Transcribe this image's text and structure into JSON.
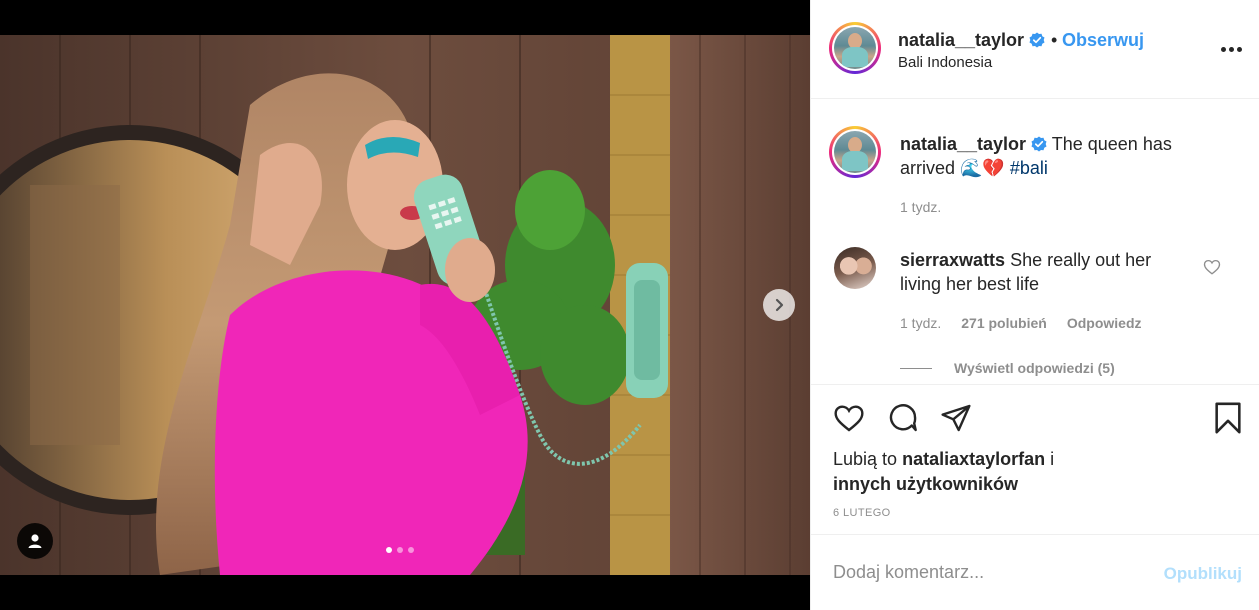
{
  "post": {
    "username": "natalia__taylor",
    "location": "Bali Indonesia",
    "follow_label": "Obserwuj",
    "separator": "•",
    "caption_text": "The queen has arrived 🌊💔",
    "hashtag": "#bali",
    "caption_time": "1 tydz.",
    "likes_prefix": "Lubią to",
    "likes_user": "nataliaxtaylorfan",
    "likes_suffix": "i",
    "likes_others": "innych użytkowników",
    "date": "6 LUTEGO",
    "carousel": {
      "count": 3,
      "active": 0
    }
  },
  "comments": [
    {
      "username": "sierraxwatts",
      "text": "She really out her living her best life",
      "time": "1 tydz.",
      "likes": "271 polubień",
      "reply_label": "Odpowiedz",
      "view_replies": "Wyświetl odpowiedzi (5)"
    }
  ],
  "comment_box": {
    "placeholder": "Dodaj komentarz...",
    "publish_label": "Opublikuj"
  },
  "colors": {
    "accent": "#3897f0",
    "publish_disabled": "#b2dffc",
    "hashtag": "#00376b",
    "muted": "#8e8e8e"
  },
  "icons": {
    "header_more": "more-horizontal-icon",
    "verified": "verified-badge-icon",
    "like": "heart-icon",
    "comment": "comment-bubble-icon",
    "share": "paper-plane-icon",
    "save": "bookmark-icon",
    "next": "chevron-right-icon",
    "tagged": "user-icon"
  }
}
